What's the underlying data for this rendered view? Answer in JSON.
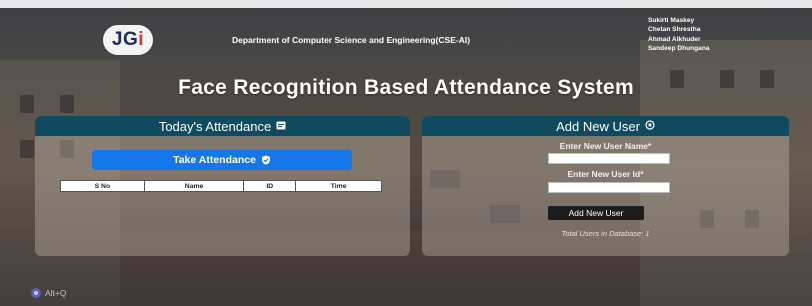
{
  "logo": {
    "text_main": "JG",
    "text_accent": "i"
  },
  "header": {
    "department": "Department of Computer Science and Engineering(CSE-AI)",
    "members": [
      "Sukirti Maskey",
      "Chetan Shrestha",
      "Ahmad Alkhuder",
      "Sandeep Dhungana"
    ]
  },
  "title": "Face Recognition Based Attendance System",
  "attendance_panel": {
    "title": "Today's Attendance",
    "title_icon": "calendar-icon",
    "take_button": "Take Attendance",
    "take_button_icon": "shield-check-icon",
    "columns": [
      "S No",
      "Name",
      "ID",
      "Time"
    ]
  },
  "add_user_panel": {
    "title": "Add New User",
    "title_icon": "user-add-icon",
    "name_label": "Enter New User Name*",
    "name_value": "",
    "id_label": "Enter New User Id*",
    "id_value": "",
    "submit_button": "Add New User",
    "total_text": "Total Users in Database: 1"
  },
  "shortcut": {
    "label": "Alt+Q"
  },
  "colors": {
    "panel_header": "#0f4a5e",
    "primary_button": "#1677e8",
    "dark_button": "#1c1c1c",
    "logo_accent": "#d9362a"
  }
}
